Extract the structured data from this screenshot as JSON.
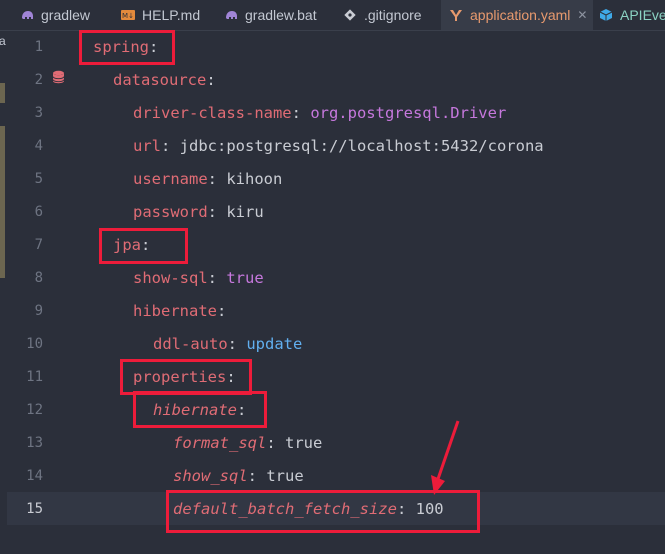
{
  "tabs": [
    {
      "label": "gradlew",
      "icon": "elephant-icon",
      "active": false
    },
    {
      "label": "HELP.md",
      "icon": "markdown-icon",
      "active": false
    },
    {
      "label": "gradlew.bat",
      "icon": "elephant-icon",
      "active": false
    },
    {
      "label": ".gitignore",
      "icon": "git-icon",
      "active": false
    },
    {
      "label": "application.yaml",
      "icon": "yaml-icon",
      "active": true,
      "close": "✕"
    },
    {
      "label": "APIEver",
      "icon": "cube-icon",
      "active": false
    }
  ],
  "left_strip_label": "a",
  "lines": [
    {
      "n": "1",
      "key": "spring",
      "sep": ":",
      "value": ""
    },
    {
      "n": "2",
      "key": "datasource",
      "sep": ":",
      "value": ""
    },
    {
      "n": "3",
      "key": "driver-class-name",
      "sep": ": ",
      "value": "org.postgresql.Driver"
    },
    {
      "n": "4",
      "key": "url",
      "sep": ": ",
      "value": "jdbc:postgresql://localhost:5432/corona"
    },
    {
      "n": "5",
      "key": "username",
      "sep": ": ",
      "value": "kihoon"
    },
    {
      "n": "6",
      "key": "password",
      "sep": ": ",
      "value": "kiru"
    },
    {
      "n": "7",
      "key": "jpa",
      "sep": ":",
      "value": ""
    },
    {
      "n": "8",
      "key": "show-sql",
      "sep": ": ",
      "value": "true"
    },
    {
      "n": "9",
      "key": "hibernate",
      "sep": ":",
      "value": ""
    },
    {
      "n": "10",
      "key": "ddl-auto",
      "sep": ": ",
      "value": "update"
    },
    {
      "n": "11",
      "key": "properties",
      "sep": ":",
      "value": ""
    },
    {
      "n": "12",
      "key": "hibernate",
      "sep": ":",
      "value": ""
    },
    {
      "n": "13",
      "key": "format_sql",
      "sep": ": ",
      "value": "true"
    },
    {
      "n": "14",
      "key": "show_sql",
      "sep": ": ",
      "value": "true"
    },
    {
      "n": "15",
      "key": "default_batch_fetch_size",
      "sep": ": ",
      "value": "100"
    }
  ],
  "current_line": "15",
  "colors": {
    "background": "#2b2f3a",
    "key": "#e06c75",
    "package_value": "#c678dd",
    "enum_value": "#61afef",
    "active_tab_label": "#e89a6e",
    "annotation": "#ed1c3a"
  }
}
